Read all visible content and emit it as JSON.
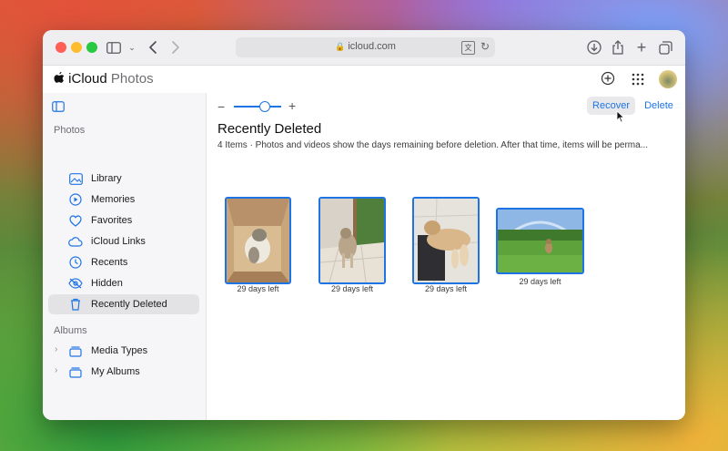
{
  "browser": {
    "url": "icloud.com"
  },
  "app": {
    "brand_bold": "iCloud",
    "brand_light": "Photos"
  },
  "sidebar": {
    "photos_section": "Photos",
    "items": [
      {
        "label": "Library",
        "icon": "library-icon"
      },
      {
        "label": "Memories",
        "icon": "memories-icon"
      },
      {
        "label": "Favorites",
        "icon": "heart-icon"
      },
      {
        "label": "iCloud Links",
        "icon": "cloud-link-icon"
      },
      {
        "label": "Recents",
        "icon": "clock-icon"
      },
      {
        "label": "Hidden",
        "icon": "eye-slash-icon"
      },
      {
        "label": "Recently Deleted",
        "icon": "trash-icon"
      }
    ],
    "albums_section": "Albums",
    "albums": [
      {
        "label": "Media Types",
        "icon": "stack-icon"
      },
      {
        "label": "My Albums",
        "icon": "stack-icon"
      }
    ]
  },
  "main": {
    "recover_label": "Recover",
    "delete_label": "Delete",
    "title": "Recently Deleted",
    "subtitle": "4 Items  ·  Photos and videos show the days remaining before deletion. After that time, items will be perma...",
    "tiles": [
      {
        "label": "29 days left"
      },
      {
        "label": "29 days left"
      },
      {
        "label": "29 days left"
      },
      {
        "label": "29 days left"
      }
    ]
  },
  "colors": {
    "accent": "#1f74e4"
  }
}
